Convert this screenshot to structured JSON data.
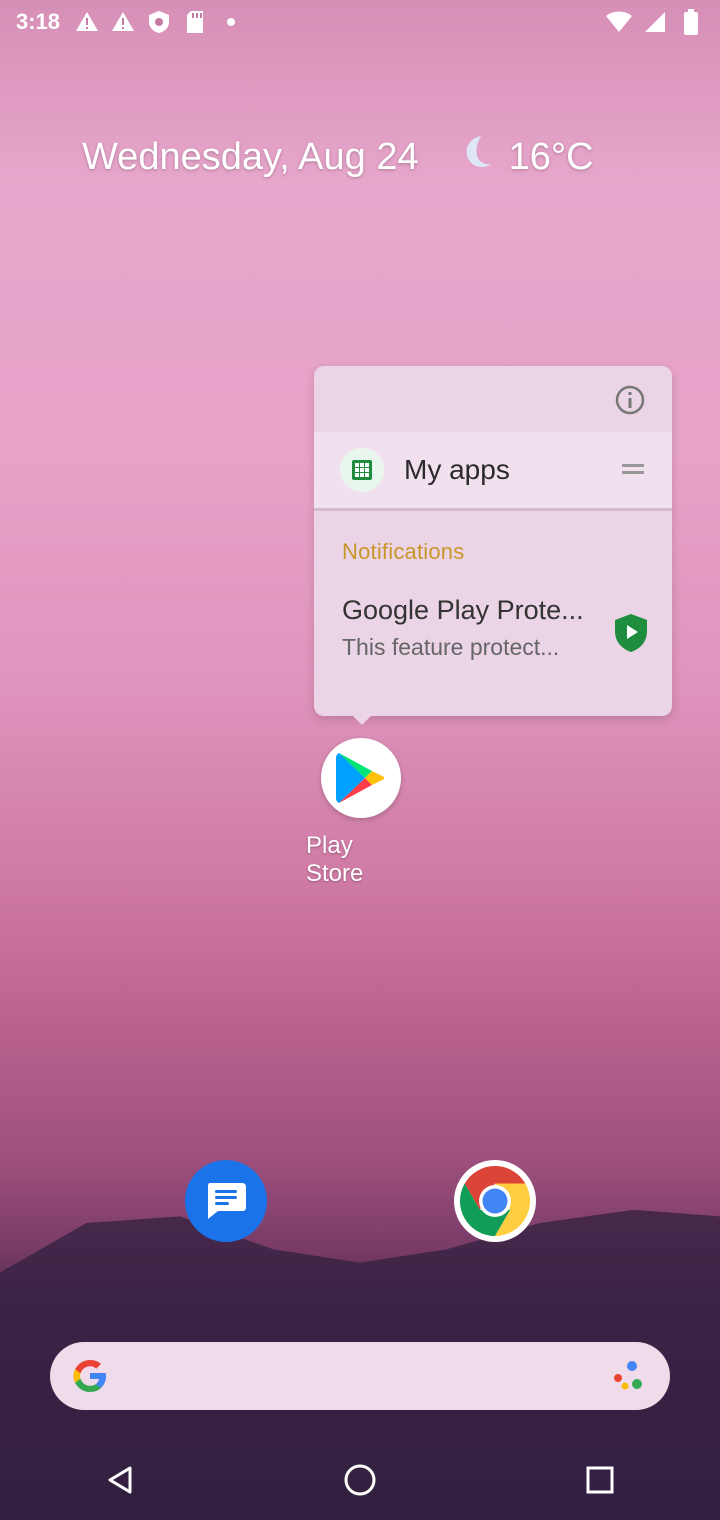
{
  "status_bar": {
    "time": "3:18",
    "left_icons": [
      "alert-icon",
      "alert-icon",
      "shield-icon",
      "sd-card-icon",
      "dot-icon"
    ],
    "right_icons": [
      "wifi-icon",
      "signal-icon",
      "battery-icon"
    ]
  },
  "widget": {
    "date": "Wednesday, Aug 24",
    "weather_icon": "moon-icon",
    "temperature": "16°C"
  },
  "popup": {
    "info_icon": "info-icon",
    "shortcut_label": "My apps",
    "notifications_title": "Notifications",
    "notification": {
      "title": "Google Play Prote...",
      "body": "This feature protect..."
    }
  },
  "apps": {
    "play_store": {
      "label": "Play Store"
    }
  },
  "dock": [
    "messages-icon",
    "chrome-icon"
  ],
  "search": {
    "placeholder": ""
  },
  "nav": [
    "back-icon",
    "home-icon",
    "recents-icon"
  ],
  "colors": {
    "accent_notif": "#c9962a",
    "popup_bg": "#ead4e5",
    "play_protect_green": "#1e8e3e"
  }
}
